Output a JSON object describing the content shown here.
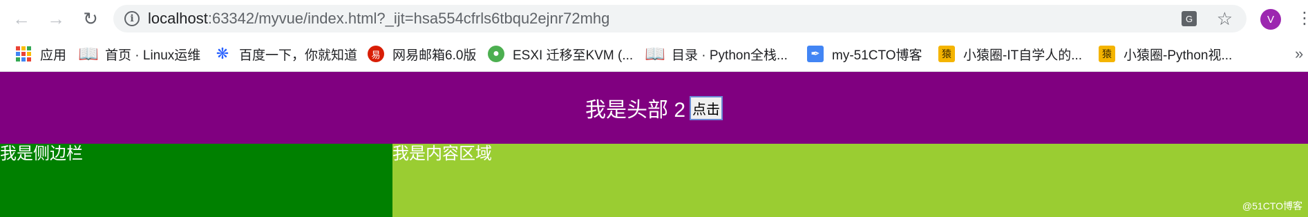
{
  "browser": {
    "url_host": "localhost",
    "url_rest": ":63342/myvue/index.html?_ijt=hsa554cfrls6tbqu2ejnr72mhg",
    "profile_initial": "V",
    "bookmarks": [
      {
        "label": "应用",
        "icon": "apps-icon"
      },
      {
        "label": "首页 · Linux运维",
        "icon": "book-icon"
      },
      {
        "label": "百度一下，你就知道",
        "icon": "baidu-paw-icon"
      },
      {
        "label": "网易邮箱6.0版",
        "icon": "netease-icon"
      },
      {
        "label": "ESXI 迁移至KVM (...",
        "icon": "frog-icon"
      },
      {
        "label": "目录 · Python全栈...",
        "icon": "book-icon"
      },
      {
        "label": "my-51CTO博客",
        "icon": "feather-icon"
      },
      {
        "label": "小猿圈-IT自学人的...",
        "icon": "ape-icon"
      },
      {
        "label": "小猿圈-Python视...",
        "icon": "ape-icon"
      }
    ],
    "more_glyph": "»"
  },
  "page": {
    "header_title": "我是头部 2",
    "header_button": "点击",
    "sidebar_text": "我是侧边栏",
    "content_text": "我是内容区域",
    "watermark": "@51CTO博客"
  },
  "colors": {
    "header_bg": "#800080",
    "sidebar_bg": "#008000",
    "content_bg": "#9acd32"
  }
}
